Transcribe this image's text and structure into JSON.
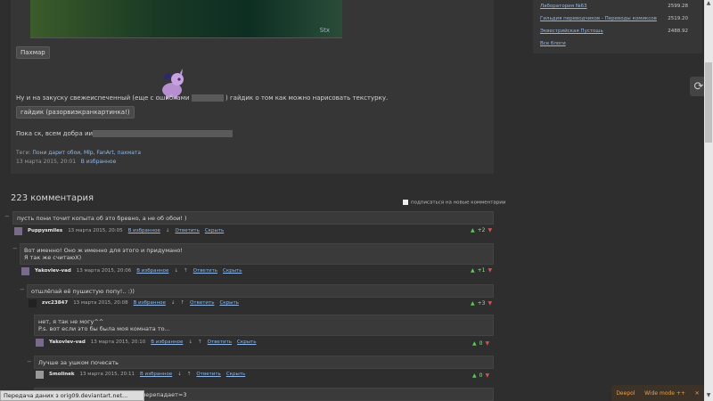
{
  "post": {
    "image_signature": "Stx",
    "pahmar_button": "Пахмар",
    "line1_before": "Ну и на закуску свежеиспеченный (еще с ошибками",
    "line1_after": ") гайдик о том как можно нарисовать текстурку.",
    "guide_button": "гайдик (разорвиэкранкартинка!)",
    "bye_text": "Пока ск, всем добра ииииии",
    "tags_label": "Теги:",
    "tags": "Пони дарит обои, Mlp, FanArt, пахмата",
    "date": "13 марта 2015, 20:01",
    "favorites": "В избранное"
  },
  "sidebar": {
    "rows": [
      {
        "name": "Лаборатория №63",
        "value": "2599.28"
      },
      {
        "name": "Гильдия переводчиков - Переводы комиксов",
        "value": "2519.20"
      },
      {
        "name": "Эквестрийская Пустошь",
        "value": "2488.92"
      }
    ],
    "all_blogs": "Все блоги"
  },
  "comments_header": {
    "title": "223 комментария",
    "subscribe": "подписаться на новые комментарии"
  },
  "comments": [
    {
      "text": "пусть пони точит копыта об это бревно, а не об обои! )",
      "user": "Puppysmiles",
      "date": "13 марта 2015, 20:05",
      "fav": "В избранное",
      "reply": "Ответить",
      "hide": "Скрыть",
      "score": "+2"
    },
    {
      "text1": "Вот именно! Оно ж именно для этого и придумано!",
      "text2": "Я так же считаюХ)",
      "user": "Yakovlev-vad",
      "date": "13 марта 2015, 20:06",
      "fav": "В избранное",
      "reply": "Ответить",
      "hide": "Скрыть",
      "score": "+1"
    },
    {
      "text": "отшлёпай её пушистую попу!.. :))",
      "user": "zvc23847",
      "date": "13 марта 2015, 20:08",
      "fav": "В избранное",
      "reply": "Ответить",
      "hide": "Скрыть",
      "score": "+3"
    },
    {
      "text1": "нет, я так не могу^^",
      "text2": "P.s. вот если это бы была моя комната то...",
      "user": "Yakovlev-vad",
      "date": "13 марта 2015, 20:10",
      "fav": "В избранное",
      "reply": "Ответить",
      "hide": "Скрыть",
      "score": "0"
    },
    {
      "text": "Лучше за ушком почесать",
      "user": "Smolinek",
      "date": "13 марта 2015, 20:11",
      "fav": "В избранное",
      "reply": "Ответить",
      "hide": "Скрыть",
      "score": "0"
    },
    {
      "text": "перепадает=3"
    }
  ],
  "status_bar": "Передача даних з orig09.deviantart.net...",
  "bottom_bar": {
    "item1": "Deepol",
    "item2": "Wide mode ++"
  },
  "icons": {
    "refresh": "refresh-icon",
    "thumb_up": "thumb-up-icon",
    "thumb_down": "thumb-down-icon"
  }
}
